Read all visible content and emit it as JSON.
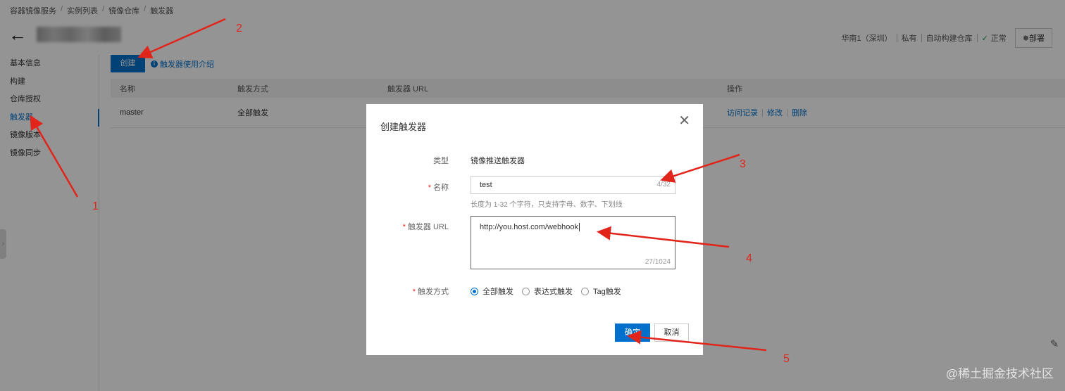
{
  "breadcrumb": [
    "容器镜像服务",
    "实例列表",
    "镜像仓库",
    "触发器"
  ],
  "header": {
    "status": [
      "华南1（深圳）",
      "私有",
      "自动构建仓库",
      "正常"
    ],
    "deploy_label": "部署"
  },
  "sidebar": {
    "items": [
      "基本信息",
      "构建",
      "仓库授权",
      "触发器",
      "镜像版本",
      "镜像同步"
    ]
  },
  "toolbar": {
    "create_label": "创建",
    "help_label": "触发器使用介绍"
  },
  "table": {
    "headers": [
      "名称",
      "触发方式",
      "触发器 URL",
      "操作"
    ],
    "rows": [
      {
        "name": "master",
        "mode": "全部触发",
        "url": "",
        "ops": [
          "访问记录",
          "修改",
          "删除"
        ]
      }
    ]
  },
  "modal": {
    "title": "创建触发器",
    "type_label": "类型",
    "type_value": "镜像推送触发器",
    "name_label": "名称",
    "name_value": "test",
    "name_count": "4/32",
    "name_hint": "长度为 1-32 个字符，只支持字母、数字、下划线",
    "url_label": "触发器 URL",
    "url_value": "http://you.host.com/webhook",
    "url_count": "27/1024",
    "mode_label": "触发方式",
    "mode_options": [
      "全部触发",
      "表达式触发",
      "Tag触发"
    ],
    "mode_selected": "全部触发",
    "confirm_label": "确定",
    "cancel_label": "取消"
  },
  "annotations": [
    "1",
    "2",
    "3",
    "4",
    "5"
  ],
  "watermark": "@稀土掘金技术社区",
  "colors": {
    "primary": "#0070cc",
    "annotation": "#e1251b"
  }
}
